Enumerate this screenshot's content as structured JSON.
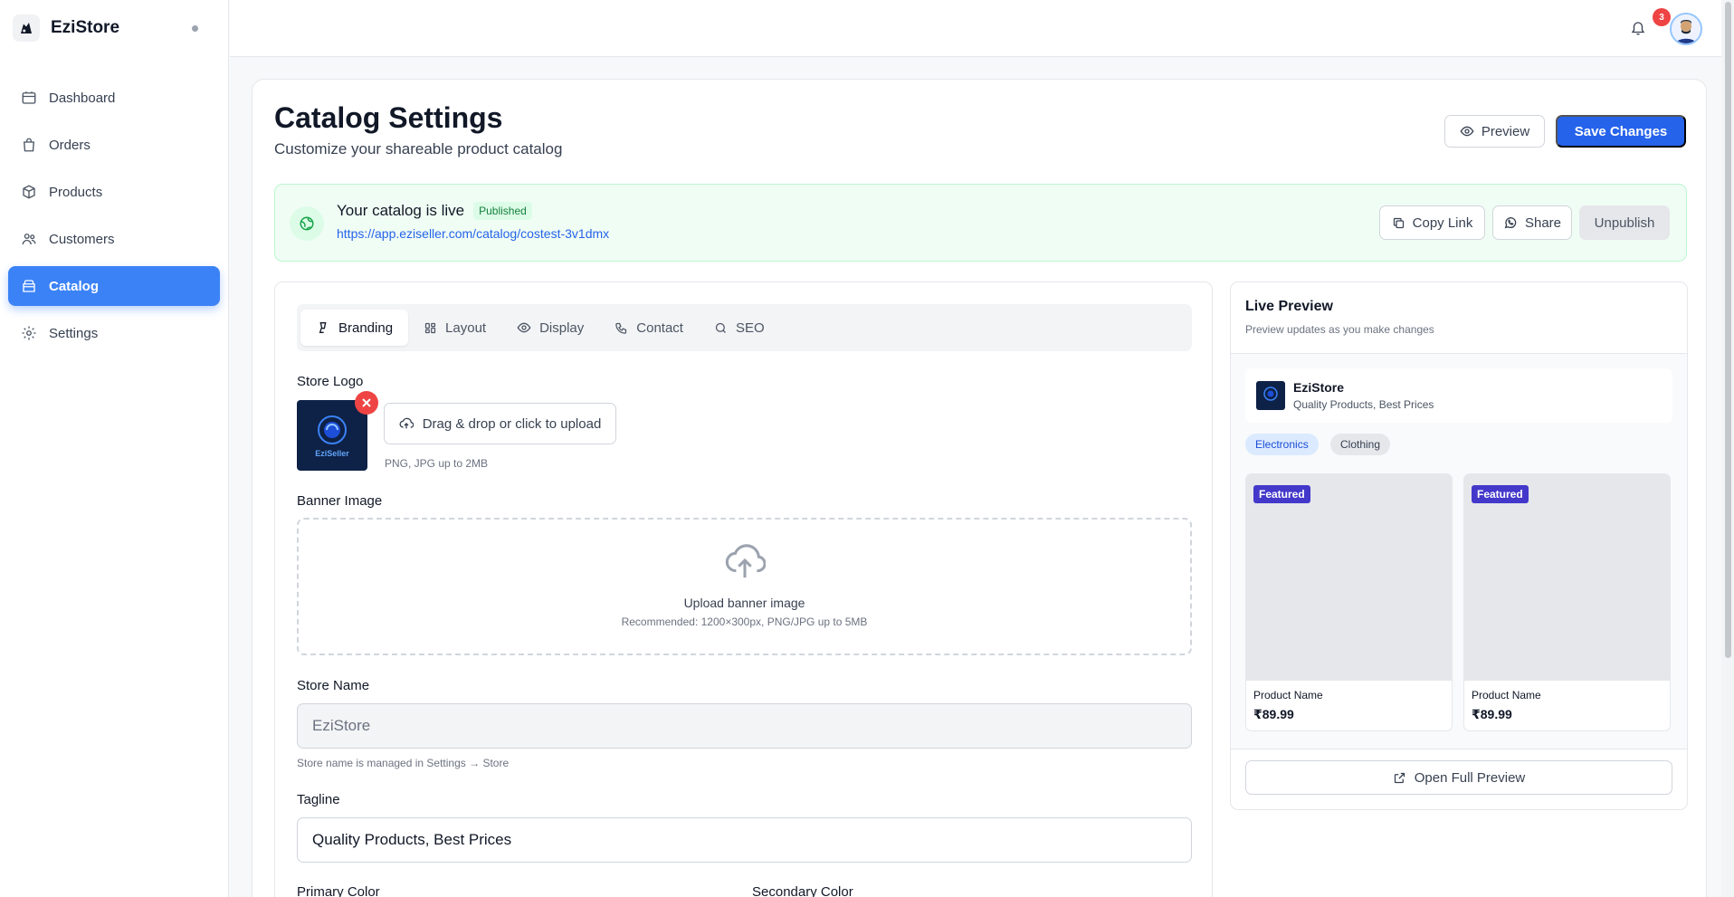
{
  "app": {
    "brand": "EziStore",
    "notification_count": "3"
  },
  "sidebar": {
    "items": [
      {
        "label": "Dashboard",
        "icon": "dashboard-icon"
      },
      {
        "label": "Orders",
        "icon": "shopping-bag-icon"
      },
      {
        "label": "Products",
        "icon": "box-icon"
      },
      {
        "label": "Customers",
        "icon": "users-icon"
      },
      {
        "label": "Catalog",
        "icon": "catalog-icon",
        "active": true
      },
      {
        "label": "Settings",
        "icon": "gear-icon"
      }
    ]
  },
  "header": {
    "title": "Catalog Settings",
    "subtitle": "Customize your shareable product catalog",
    "preview_label": "Preview",
    "save_label": "Save Changes"
  },
  "live_banner": {
    "title": "Your catalog is live",
    "badge": "Published",
    "url": "https://app.eziseller.com/catalog/costest-3v1dmx",
    "copy_label": "Copy Link",
    "share_label": "Share",
    "unpublish_label": "Unpublish"
  },
  "tabs": [
    {
      "label": "Branding",
      "active": true
    },
    {
      "label": "Layout"
    },
    {
      "label": "Display"
    },
    {
      "label": "Contact"
    },
    {
      "label": "SEO"
    }
  ],
  "form": {
    "logo_label": "Store Logo",
    "logo_text": "EziSeller",
    "upload_label": "Drag & drop or click to upload",
    "upload_hint": "PNG, JPG up to 2MB",
    "banner_label": "Banner Image",
    "banner_title": "Upload banner image",
    "banner_rec": "Recommended: 1200×300px, PNG/JPG up to 5MB",
    "store_name_label": "Store Name",
    "store_name_value": "EziStore",
    "store_name_hint": "Store name is managed in Settings → Store",
    "tagline_label": "Tagline",
    "tagline_value": "Quality Products, Best Prices",
    "primary_color_label": "Primary Color",
    "secondary_color_label": "Secondary Color"
  },
  "preview": {
    "title": "Live Preview",
    "subtitle": "Preview updates as you make changes",
    "store_name": "EziStore",
    "store_tagline": "Quality Products, Best Prices",
    "categories": [
      "Electronics",
      "Clothing"
    ],
    "products": [
      {
        "badge": "Featured",
        "name": "Product Name",
        "price": "₹89.99"
      },
      {
        "badge": "Featured",
        "name": "Product Name",
        "price": "₹89.99"
      }
    ],
    "open_label": "Open Full Preview"
  },
  "colors": {
    "primary": "#2563eb",
    "sidebar_active": "#3b82f6",
    "success_bg": "#f0fdf4",
    "featured_badge": "#4338ca"
  }
}
